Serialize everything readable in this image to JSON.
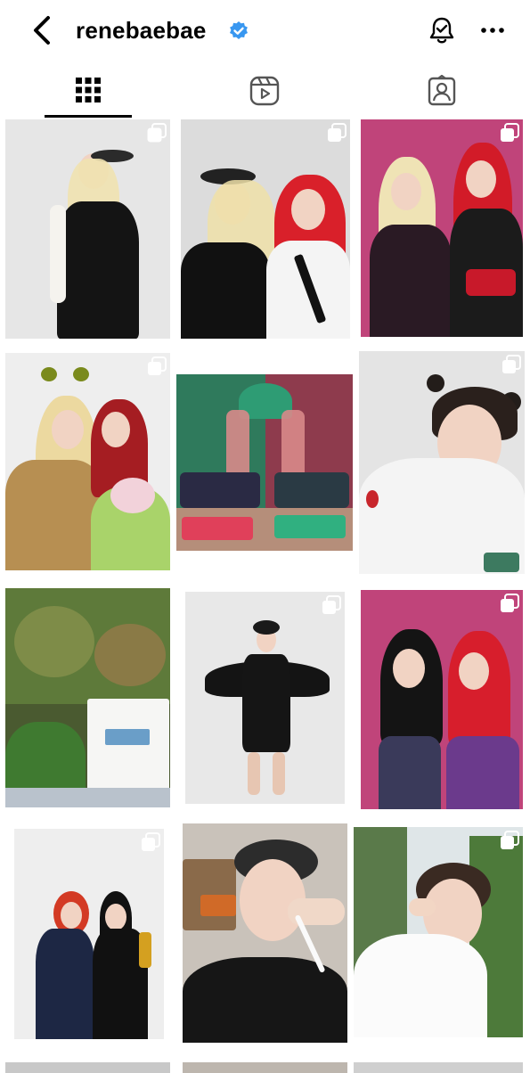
{
  "header": {
    "username": "renebaebae",
    "verified": true,
    "icons": {
      "back": "chevron-left-icon",
      "verified": "verified-badge-icon",
      "bell": "notification-bell-icon",
      "more": "more-horizontal-icon"
    }
  },
  "tabs": [
    {
      "name": "posts-grid",
      "icon": "grid-icon",
      "active": true
    },
    {
      "name": "reels",
      "icon": "reels-icon",
      "active": false
    },
    {
      "name": "tagged",
      "icon": "tagged-person-icon",
      "active": false
    }
  ],
  "grid": {
    "multi_select_icon": "multiple-photos-icon",
    "tiles": [
      {
        "description": "photo"
      },
      {
        "description": "photo"
      },
      {
        "description": "photo"
      },
      {
        "description": "photo"
      },
      {
        "description": "photo"
      },
      {
        "description": "photo"
      },
      {
        "description": "photo"
      },
      {
        "description": "photo"
      },
      {
        "description": "photo"
      },
      {
        "description": "photo"
      },
      {
        "description": "photo"
      },
      {
        "description": "photo"
      }
    ]
  },
  "colors": {
    "accent_verified": "#3897f0",
    "text": "#000000",
    "pink_wall": "#c0447a"
  }
}
